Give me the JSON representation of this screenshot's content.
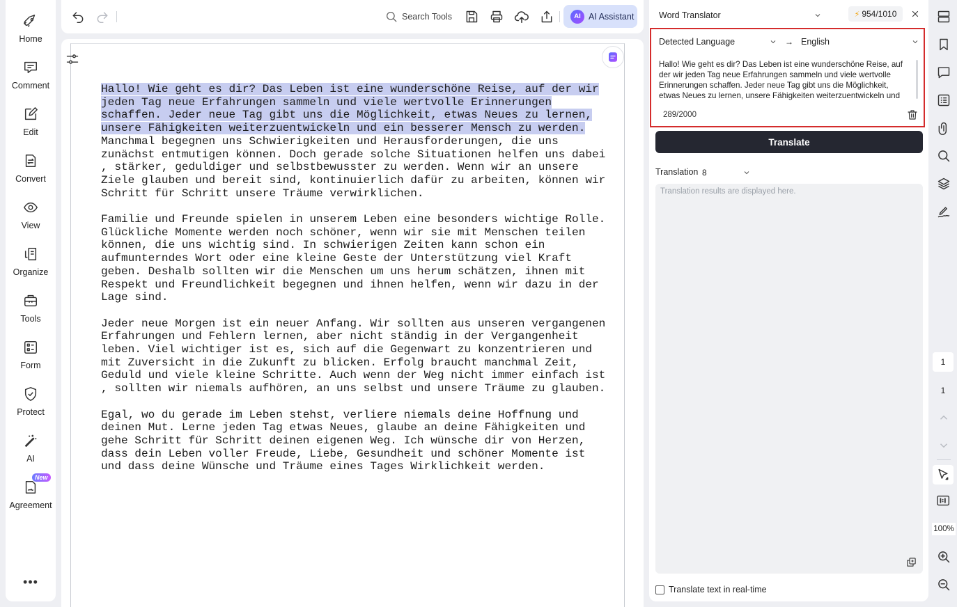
{
  "sidebar": {
    "items": [
      {
        "label": "Home",
        "icon": "rocket-icon"
      },
      {
        "label": "Comment",
        "icon": "comment-icon"
      },
      {
        "label": "Edit",
        "icon": "edit-icon"
      },
      {
        "label": "Convert",
        "icon": "convert-icon"
      },
      {
        "label": "View",
        "icon": "eye-icon"
      },
      {
        "label": "Organize",
        "icon": "organize-icon"
      },
      {
        "label": "Tools",
        "icon": "toolbox-icon"
      },
      {
        "label": "Form",
        "icon": "form-icon"
      },
      {
        "label": "Protect",
        "icon": "shield-icon"
      },
      {
        "label": "AI",
        "icon": "magic-wand-icon"
      },
      {
        "label": "Agreement",
        "icon": "agreement-icon",
        "badge": "New"
      }
    ],
    "more": "•••"
  },
  "toolbar": {
    "search_label": "Search Tools",
    "ai_logo": "AI",
    "ai_label": "AI Assistant"
  },
  "document": {
    "paragraphs": [
      {
        "highlighted_lines": [
          "Hallo! Wie geht es dir? Das Leben ist eine wunderschöne Reise, auf der wir",
          "jeden Tag neue Erfahrungen sammeln und viele wertvolle Erinnerungen",
          "schaffen. Jeder neue Tag gibt uns die Möglichkeit, etwas Neues zu lernen,",
          "unsere Fähigkeiten weiterzuentwickeln und ein besserer Mensch zu werden."
        ],
        "lines": [
          "Manchmal begegnen uns Schwierigkeiten und Herausforderungen, die uns",
          "zunächst entmutigen können. Doch gerade solche Situationen helfen uns dabei",
          ", stärker, geduldiger und selbstbewusster zu werden. Wenn wir an unsere",
          "Ziele glauben und bereit sind, kontinuierlich dafür zu arbeiten, können wir",
          "Schritt für Schritt unsere Träume verwirklichen."
        ]
      },
      {
        "lines": [
          "Familie und Freunde spielen in unserem Leben eine besonders wichtige Rolle.",
          "Glückliche Momente werden noch schöner, wenn wir sie mit Menschen teilen",
          "können, die uns wichtig sind. In schwierigen Zeiten kann schon ein",
          "aufmunterndes Wort oder eine kleine Geste der Unterstützung viel Kraft",
          "geben. Deshalb sollten wir die Menschen um uns herum schätzen, ihnen mit",
          "Respekt und Freundlichkeit begegnen und ihnen helfen, wenn wir dazu in der",
          "Lage sind."
        ]
      },
      {
        "lines": [
          "Jeder neue Morgen ist ein neuer Anfang. Wir sollten aus unseren vergangenen",
          "Erfahrungen und Fehlern lernen, aber nicht ständig in der Vergangenheit",
          "leben. Viel wichtiger ist es, sich auf die Gegenwart zu konzentrieren und",
          "mit Zuversicht in die Zukunft zu blicken. Erfolg braucht manchmal Zeit,",
          "Geduld und viele kleine Schritte. Auch wenn der Weg nicht immer einfach ist",
          ", sollten wir niemals aufhören, an uns selbst und unsere Träume zu glauben."
        ]
      },
      {
        "lines": [
          "Egal, wo du gerade im Leben stehst, verliere niemals deine Hoffnung und",
          "deinen Mut. Lerne jeden Tag etwas Neues, glaube an deine Fähigkeiten und",
          "gehe Schritt für Schritt deinen eigenen Weg. Ich wünsche dir von Herzen,",
          "dass dein Leben voller Freude, Liebe, Gesundheit und schöner Momente ist",
          "und dass deine Wünsche und Träume eines Tages Wirklichkeit werden."
        ]
      }
    ]
  },
  "translator": {
    "mode": "Word Translator",
    "credits": "954/1010",
    "credits_icon": "⚡",
    "source_language": "Detected Language",
    "arrow": "→",
    "target_language": "English",
    "source_text": "Hallo! Wie geht es dir? Das Leben ist eine wunderschöne Reise, auf der wir jeden Tag neue Erfahrungen sammeln und viele wertvolle Erinnerungen schaffen. Jeder neue Tag gibt uns die Möglichkeit, etwas Neues zu lernen, unsere Fähigkeiten weiterzuentwickeln und ein besserer Mensch zu werden.",
    "char_count": "289/2000",
    "translate_button": "Translate",
    "translation_label": "Translation",
    "translation_option": "8",
    "result_placeholder": "Translation results are displayed here.",
    "realtime_label": "Translate text in real-time"
  },
  "rail": {
    "current_page": "1",
    "total_pages": "1",
    "zoom": "100%"
  },
  "colors": {
    "highlight": "#c7cdf0",
    "accent_border": "#d42c2c",
    "translate_button": "#252731",
    "ai_button_bg": "#d8e1fb"
  }
}
